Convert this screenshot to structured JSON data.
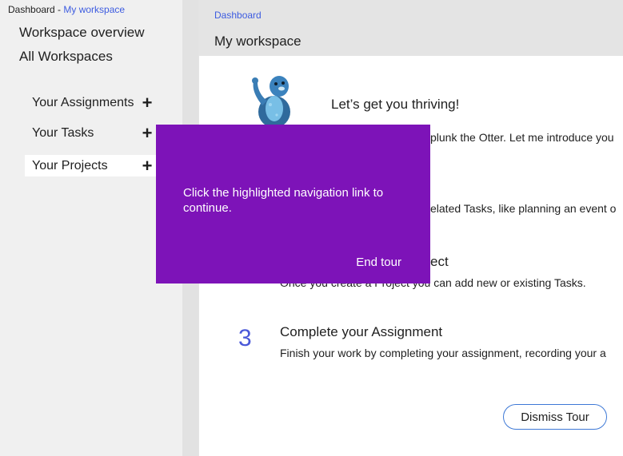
{
  "breadcrumb_top": {
    "prefix": "Dashboard - ",
    "link": "My workspace"
  },
  "sidebar": {
    "links": [
      "Workspace overview",
      "All Workspaces"
    ],
    "sections": [
      {
        "label": "Your Assignments",
        "action_icon": "plus-icon"
      },
      {
        "label": "Your Tasks",
        "action_icon": "plus-icon"
      },
      {
        "label": "Your Projects",
        "action_icon": "plus-icon",
        "active": true
      }
    ]
  },
  "main": {
    "breadcrumb": "Dashboard",
    "title": "My workspace",
    "card": {
      "mascot_icon": "otter-mascot",
      "greeting": "Let’s get you thriving!",
      "intro_visible": "plunk the Otter. Let me introduce you",
      "step1_desc_visible": "elated Tasks, like planning an event o",
      "step2_title_visible": "ect",
      "step2_desc_visible": "Once you create a Project you can add new or existing Tasks.",
      "step3_number": "3",
      "step3_title": "Complete your Assignment",
      "step3_desc": "Finish your work by completing your assignment, recording your a",
      "dismiss_label": "Dismiss Tour"
    }
  },
  "tour_overlay": {
    "message": "Click the highlighted navigation link to continue.",
    "end_label": "End tour",
    "color": "#7d13b8"
  },
  "colors": {
    "accent": "#3d5ce0",
    "number": "#4a58d8",
    "button_border": "#3d78d6"
  }
}
